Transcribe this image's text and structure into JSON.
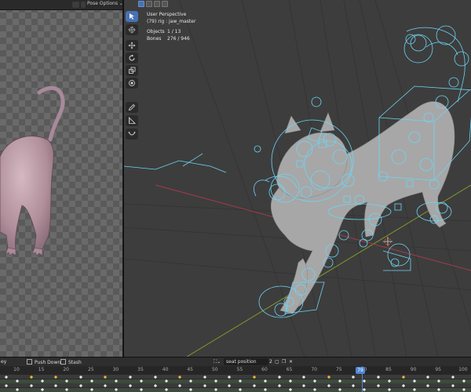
{
  "left_panel": {
    "pose_options_label": "Pose Options ⌄"
  },
  "viewport": {
    "view_name": "User Perspective",
    "object_name": "(79) rig : jaw_master",
    "objects_label": "Objects",
    "objects_value": "1 / 13",
    "bones_label": "Bones",
    "bones_value": "276 / 946"
  },
  "tools": [
    {
      "name": "select-tool",
      "icon": "cursor-icon",
      "active": true
    },
    {
      "name": "cursor-tool",
      "icon": "crosshair-icon",
      "active": false
    },
    {
      "name": "move-tool",
      "icon": "move-icon",
      "active": false
    },
    {
      "name": "rotate-tool",
      "icon": "rotate-icon",
      "active": false
    },
    {
      "name": "scale-tool",
      "icon": "scale-icon",
      "active": false
    },
    {
      "name": "transform-tool",
      "icon": "transform-icon",
      "active": false
    },
    {
      "name": "annotate-tool",
      "icon": "pencil-icon",
      "active": false
    },
    {
      "name": "measure-tool",
      "icon": "ruler-icon",
      "active": false
    },
    {
      "name": "relax-tool",
      "icon": "curve-icon",
      "active": false
    }
  ],
  "timeline": {
    "left_stub": "ey",
    "push_down_label": "Push Down",
    "stash_label": "Stash",
    "action_name": "seat position",
    "user_count": "2",
    "current_frame": "79",
    "frame_ticks": [
      "10",
      "15",
      "20",
      "25",
      "30",
      "35",
      "40",
      "45",
      "50",
      "55",
      "60",
      "65",
      "70",
      "75",
      "80",
      "85",
      "90",
      "95",
      "100"
    ],
    "accent_color": "#4f86d6",
    "key_color_selected": "#f5b731",
    "key_color": "#e6e6e6"
  }
}
